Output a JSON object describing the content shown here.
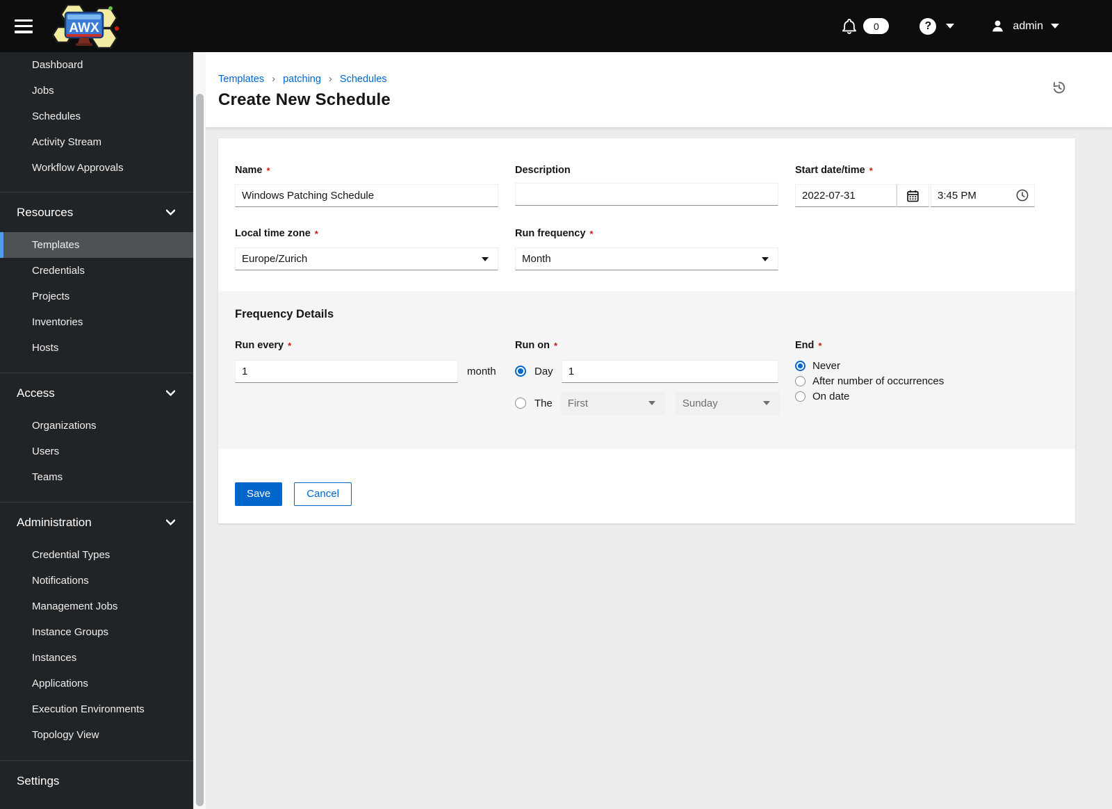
{
  "colors": {
    "accent": "#0066cc",
    "active_nav_border": "#519de9",
    "required_marker_color": "#c9190b",
    "topbar_bg": "#0d0d0d",
    "sidebar_bg": "#212427"
  },
  "symbols": {
    "required_marker": "*",
    "breadcrumb_separator": "›",
    "help_glyph": "?"
  },
  "header": {
    "brand": "AWX",
    "notification_count": "0",
    "user": "admin"
  },
  "sidebar": {
    "top_items": [
      "Dashboard",
      "Jobs",
      "Schedules",
      "Activity Stream",
      "Workflow Approvals"
    ],
    "groups": [
      {
        "label": "Resources",
        "items": [
          "Templates",
          "Credentials",
          "Projects",
          "Inventories",
          "Hosts"
        ],
        "active_item": "Templates"
      },
      {
        "label": "Access",
        "items": [
          "Organizations",
          "Users",
          "Teams"
        ]
      },
      {
        "label": "Administration",
        "items": [
          "Credential Types",
          "Notifications",
          "Management Jobs",
          "Instance Groups",
          "Instances",
          "Applications",
          "Execution Environments",
          "Topology View"
        ]
      }
    ],
    "settings_label": "Settings"
  },
  "breadcrumb": {
    "items": [
      "Templates",
      "patching",
      "Schedules"
    ]
  },
  "page": {
    "title": "Create New Schedule"
  },
  "form": {
    "name": {
      "label": "Name",
      "value": "Windows Patching Schedule"
    },
    "description": {
      "label": "Description",
      "value": ""
    },
    "start": {
      "label": "Start date/time",
      "date": "2022-07-31",
      "time": "3:45 PM"
    },
    "timezone": {
      "label": "Local time zone",
      "value": "Europe/Zurich"
    },
    "run_frequency": {
      "label": "Run frequency",
      "value": "Month"
    },
    "frequency_details": {
      "title": "Frequency Details",
      "run_every": {
        "label": "Run every",
        "value": "1",
        "unit": "month"
      },
      "run_on": {
        "label": "Run on",
        "day_label": "Day",
        "day_value": "1",
        "the_label": "The",
        "ordinal": "First",
        "weekday": "Sunday"
      },
      "end": {
        "label": "End",
        "option_never": "Never",
        "option_occurrences": "After number of occurrences",
        "option_on_date": "On date",
        "selected": "Never"
      }
    },
    "actions": {
      "save": "Save",
      "cancel": "Cancel"
    }
  }
}
